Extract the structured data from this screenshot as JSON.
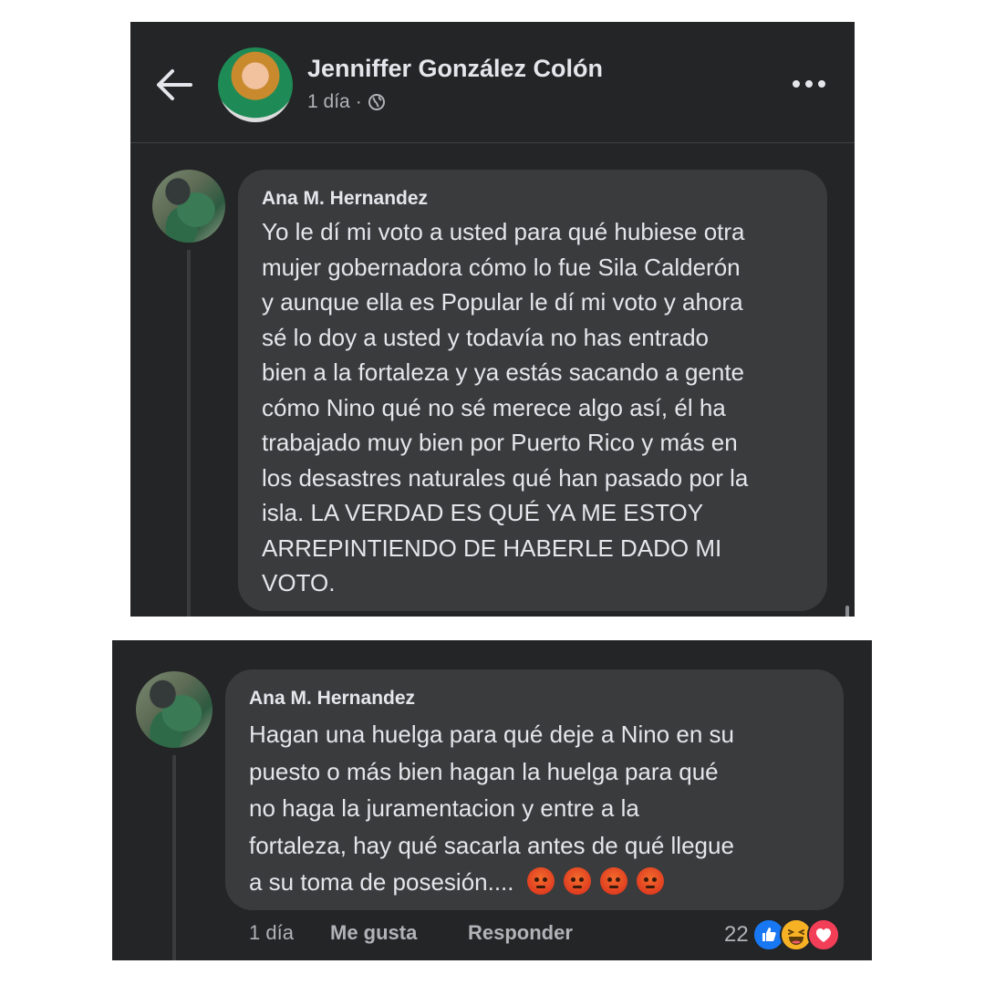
{
  "header": {
    "page_name": "Jenniffer González Colón",
    "post_time": "1 día",
    "separator": "·",
    "back_icon": "back-arrow-icon",
    "privacy_icon": "globe-icon",
    "more_icon": "more-options-icon"
  },
  "comment1": {
    "author": "Ana M. Hernandez",
    "lines": [
      "Yo le dí mi voto a usted para qué hubiese otra",
      "mujer gobernadora cómo lo fue Sila Calderón",
      "y aunque ella es Popular le dí mi voto y ahora",
      "sé lo doy a usted y todavía no has entrado",
      "bien a la fortaleza y ya estás sacando a gente",
      "cómo Nino qué no sé merece algo así, él ha",
      "trabajado muy bien por Puerto Rico y más en",
      "los desastres naturales qué han pasado por la",
      "isla. LA VERDAD ES QUÉ YA ME ESTOY",
      "ARREPINTIENDO DE HABERLE DADO MI",
      "VOTO."
    ]
  },
  "comment2": {
    "author": "Ana M. Hernandez",
    "lines": [
      "Hagan una huelga para qué deje a Nino en su",
      "puesto o más bien hagan la huelga para qué",
      "no haga la juramentacion y entre a la",
      "fortaleza, hay qué sacarla antes de qué llegue",
      "a su toma de posesión...."
    ],
    "emojis": [
      "angry-face-icon",
      "angry-face-icon",
      "angry-face-icon",
      "angry-face-icon"
    ],
    "time": "1 día",
    "like_label": "Me gusta",
    "reply_label": "Responder",
    "reaction_count": "22",
    "reaction_icons": [
      "like-reaction-icon",
      "haha-reaction-icon",
      "love-reaction-icon"
    ]
  }
}
